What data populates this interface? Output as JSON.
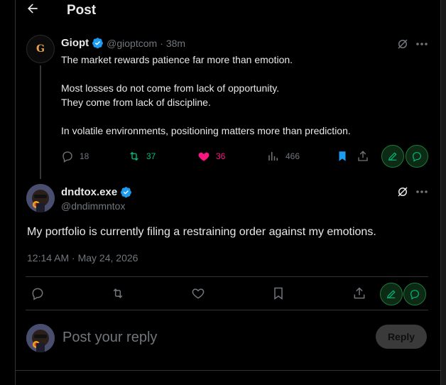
{
  "header": {
    "title": "Post"
  },
  "parent_post": {
    "avatar_letter": "G",
    "name": "Giopt",
    "handle": "@gioptcom",
    "time": "38m",
    "lines": [
      "The market rewards patience far more than emotion.",
      "Most losses do not come from lack of opportunity.\nThey come from lack of discipline.",
      "In volatile environments, positioning matters more than prediction."
    ],
    "replies": "18",
    "reposts": "37",
    "likes": "36",
    "views": "466"
  },
  "main_post": {
    "name": "dndtox.exe",
    "handle": "@dndimmntox",
    "text": "My portfolio is currently filing a restraining order against my emotions.",
    "timestamp": "12:14 AM · May 24, 2026"
  },
  "reply_box": {
    "placeholder": "Post your reply",
    "button_label": "Reply"
  },
  "colors": {
    "background": "#000000",
    "text": "#e7e9ea",
    "muted": "#71767b",
    "verified": "#1d9bf0",
    "repost_green": "#00ba7c",
    "like_pink": "#f91880",
    "bookmark_blue": "#1d9bf0",
    "grok_green": "#1f7a3a"
  },
  "icons": {
    "back": "arrow-left-icon",
    "verified": "verified-badge-icon",
    "grok": "grok-icon",
    "more": "more-dots-icon",
    "reply": "reply-icon",
    "repost": "repost-icon",
    "like": "heart-icon",
    "views": "views-icon",
    "bookmark": "bookmark-icon",
    "share": "share-icon",
    "edit": "pencil-icon",
    "chat": "chat-bubble-icon"
  }
}
